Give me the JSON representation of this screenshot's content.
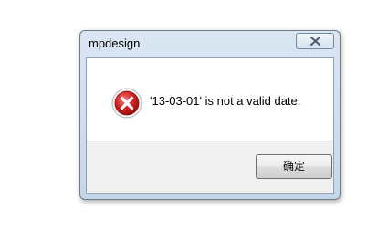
{
  "dialog": {
    "title": "mpdesign",
    "message": "'13-03-01' is not a valid date.",
    "icon": "error-icon",
    "buttons": {
      "ok_label": "确定"
    }
  },
  "colors": {
    "error_red": "#c91d1d",
    "frame": "#c6d6ea"
  }
}
